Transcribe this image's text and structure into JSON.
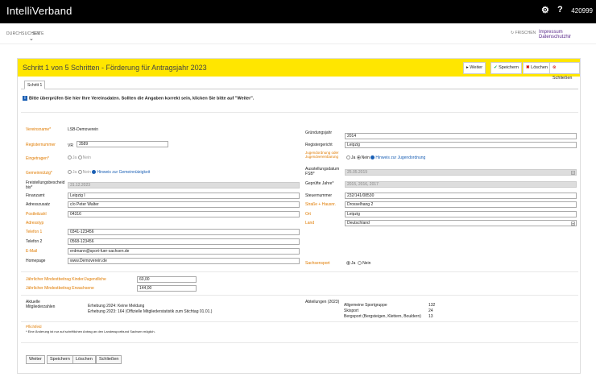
{
  "app": {
    "title": "IntelliVerband",
    "user_number": "420999"
  },
  "subnav": {
    "item1": "DURCHSUCHEN",
    "item2": "SEITE",
    "refresh_label": "FRISCHEN",
    "links": "Impressum Datenschutzhir"
  },
  "panel": {
    "title": "Schritt 1 von 5 Schritten - Förderung für Antragsjahr 2023",
    "buttons": {
      "weiter": "Weiter",
      "speichern": "Speichern",
      "loeschen": "Löschen",
      "schliessen": "Schließen"
    },
    "tab": "Schritt 1",
    "info": "Bitte überprüfen Sie hier Ihre Vereinsdaten. Sollten die Angaben korrekt sein, klicken Sie bitte auf \"Weiter\"."
  },
  "form": {
    "vereinsname": {
      "label": "Vereinsname*",
      "value": "LSB-Demoverein"
    },
    "registernummer": {
      "label": "Registernummer",
      "prefix": "VR",
      "value": "3589"
    },
    "eingetragen": {
      "label": "Eingetragen*",
      "ja": "Ja",
      "nein": "Nein"
    },
    "gemeinnuetzig": {
      "label": "Gemeinnützig*",
      "ja": "Ja",
      "nein": "Nein",
      "hint": "Hinweis zur Gemeinnützigkeit"
    },
    "freistellung": {
      "label": "Freistellungsbescheid bis*",
      "value": "31.12.2023"
    },
    "finanzamt": {
      "label": "Finanzamt",
      "value": "Leipzig I"
    },
    "adresszusatz": {
      "label": "Adresszusatz",
      "value": "c/o Peter Walter"
    },
    "postleitzahl": {
      "label": "Postleitzahl",
      "value": "04316"
    },
    "adresstyp": {
      "label": "Adresstyp"
    },
    "telefon1": {
      "label": "Telefon 1",
      "value": "0341-123456"
    },
    "telefon2": {
      "label": "Telefon 2",
      "value": "0568-123456"
    },
    "email": {
      "label": "E-Mail",
      "value": "erdmann@sport-fuer-sachsen.de"
    },
    "homepage": {
      "label": "Homepage",
      "value": "www.Demoverein.de"
    },
    "gruendungsjahr": {
      "label": "Gründungsjahr",
      "value": "2014"
    },
    "registergericht": {
      "label": "Registergericht",
      "value": "Leipzig"
    },
    "jugendordnung": {
      "label": "Jugendordnung oder Jugendvereinbarung",
      "ja": "Ja",
      "nein": "Nein",
      "hint": "Hinweis zur Jugendordnung"
    },
    "ausstellungsdatum": {
      "label": "Ausstellungsdatum FSB*",
      "value": "25.05.2019"
    },
    "gepruefte_jahre": {
      "label": "Geprüfte Jahre*",
      "value": "2015, 2016, 2017"
    },
    "steuernummer": {
      "label": "Steuernummer",
      "value": "232/141/08530"
    },
    "strasse": {
      "label": "Straße + Hausnr.",
      "value": "Drosselhang 2"
    },
    "ort": {
      "label": "Ort",
      "value": "Leipzig"
    },
    "land": {
      "label": "Land",
      "value": "Deutschland"
    },
    "sachsensport": {
      "label": "Sachsensport",
      "ja": "Ja",
      "nein": "Nein"
    },
    "beitrag_kinder": {
      "label": "Jährlicher Mindestbeitrag Kinder/Jugendliche",
      "value": "60,00"
    },
    "beitrag_erwachsene": {
      "label": "Jährlicher Mindestbeitrag Erwachsene",
      "value": "144,00"
    },
    "mitgliederzahlen": {
      "label": "Aktuelle Mitgliederzahlen",
      "line1": "Erhebung 2024: Keine Meldung",
      "line2": "Erhebung 2023: 164 (Offizielle Mitgliederstatistik zum Stichtag 01.01.)"
    },
    "abteilungen": {
      "label": "Abteilungen (2023)",
      "rows": [
        {
          "name": "Allgemeine Sportgruppe",
          "count": "132"
        },
        {
          "name": "Skisport",
          "count": "24"
        },
        {
          "name": "Bergsport (Bergsteigen, Klettern, Bouldern)",
          "count": "13"
        }
      ]
    },
    "pflicht": {
      "label": "Pflichtfeld",
      "note": "* Eine Änderung ist nur auf schriftlichen Antrag an den Landessportbund Sachsen möglich."
    }
  },
  "footer_buttons": {
    "weiter": "Weiter",
    "speichern": "Speichern",
    "loeschen": "Löschen",
    "schliessen": "Schließen"
  },
  "colors": {
    "accent": "#ffe600",
    "label_orange": "#e07b00",
    "link_blue": "#1a5fb4"
  }
}
